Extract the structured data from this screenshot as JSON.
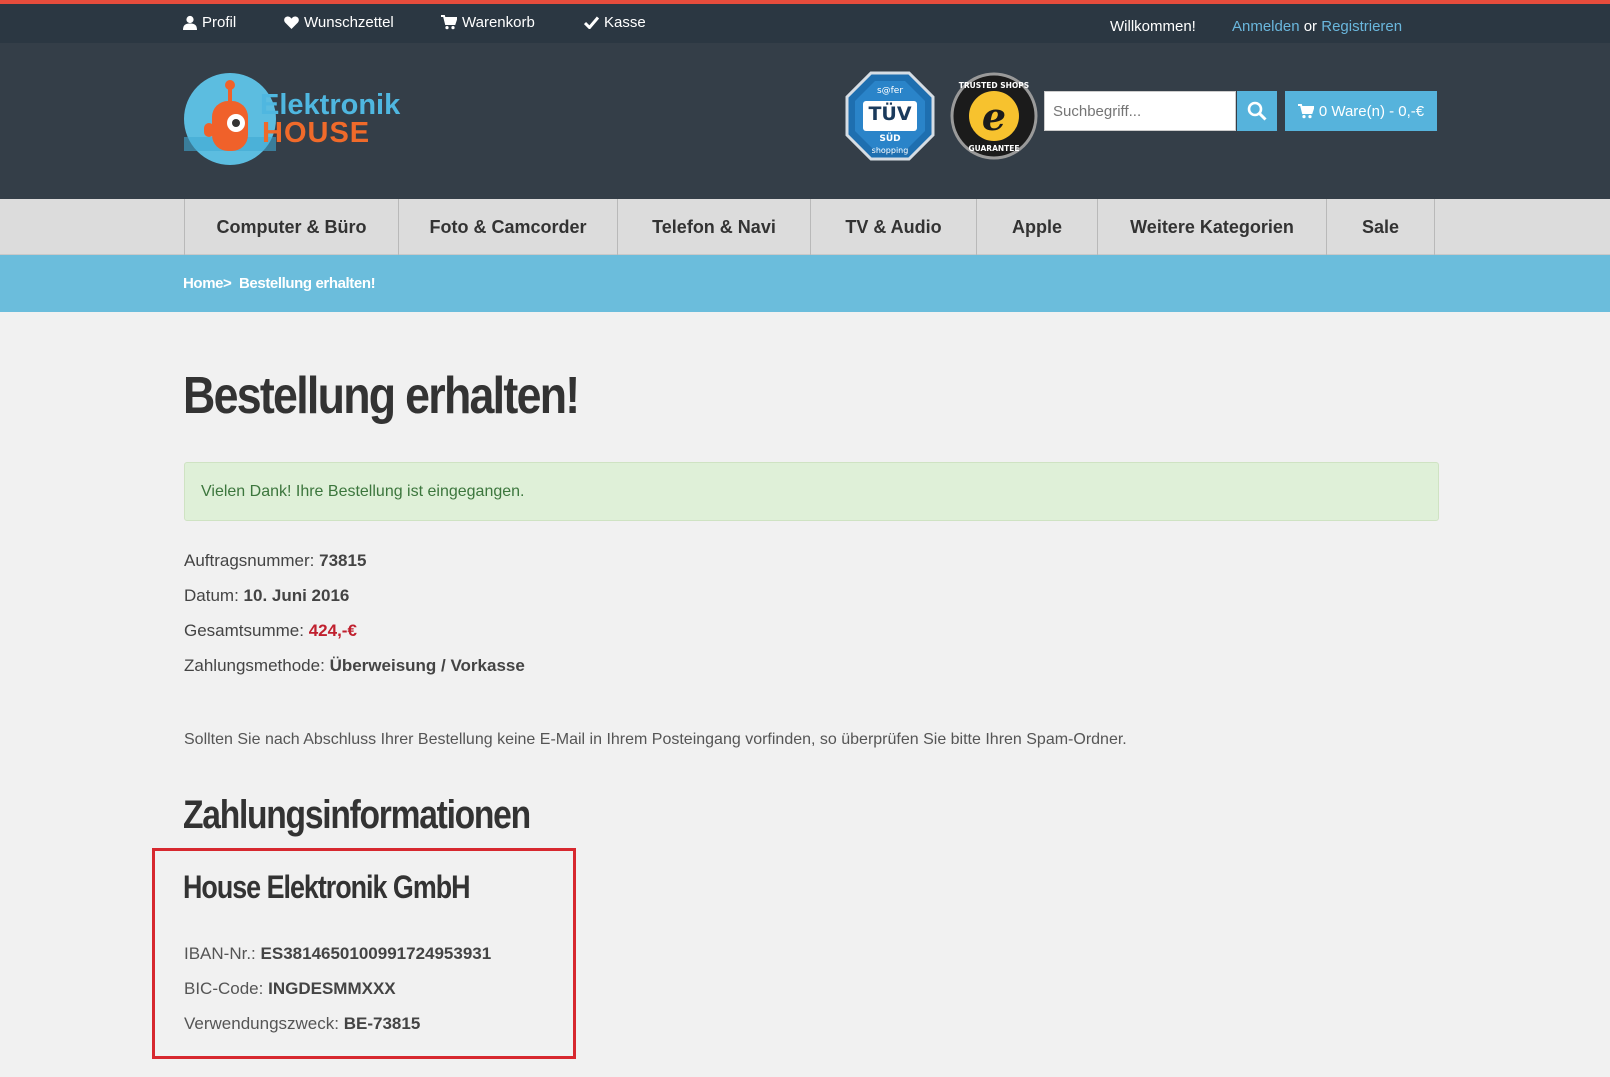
{
  "topbar": {
    "profile_label": "Profil",
    "wishlist_label": "Wunschzettel",
    "cart_label": "Warenkorb",
    "checkout_label": "Kasse",
    "welcome": "Willkommen!",
    "login_label": "Anmelden",
    "or_label": "or",
    "register_label": "Registrieren"
  },
  "header": {
    "logo_line1": "Elektronik",
    "logo_line2": "HOUSE",
    "tuv_top": "s@fer",
    "tuv_main": "TÜV",
    "tuv_sub": "SÜD",
    "tuv_bottom": "shopping",
    "trusted_top": "TRUSTED SHOPS",
    "trusted_bottom": "GUARANTEE",
    "trusted_letter": "e",
    "search_placeholder": "Suchbegriff...",
    "cart_summary": "0 Ware(n) - 0,-€"
  },
  "nav": {
    "items": [
      "Computer & Büro",
      "Foto & Camcorder",
      "Telefon & Navi",
      "TV & Audio",
      "Apple",
      "Weitere Kategorien",
      "Sale"
    ]
  },
  "breadcrumb": {
    "home": "Home",
    "separator": ">",
    "current": "Bestellung erhalten!"
  },
  "main": {
    "title": "Bestellung erhalten!",
    "success_message": "Vielen Dank! Ihre Bestellung ist eingegangen.",
    "order_number_label": "Auftragsnummer:",
    "order_number": "73815",
    "date_label": "Datum:",
    "date": "10. Juni 2016",
    "total_label": "Gesamtsumme:",
    "total": "424,-€",
    "payment_label": "Zahlungsmethode:",
    "payment_method": "Überweisung / Vorkasse",
    "spam_note": "Sollten Sie nach Abschluss Ihrer Bestellung keine E-Mail in Ihrem Posteingang vorfinden, so überprüfen Sie bitte Ihren Spam-Ordner."
  },
  "payment_info": {
    "heading": "Zahlungsinformationen",
    "company": "House Elektronik GmbH",
    "iban_label": "IBAN-Nr.:",
    "iban": "ES3814650100991724953931",
    "bic_label": "BIC-Code:",
    "bic": "INGDESMMXXX",
    "reference_label": "Verwendungszweck:",
    "reference": "BE-73815"
  },
  "colors": {
    "topbar_bg": "#2b3742",
    "topbar_accent": "#e74c3c",
    "header_bg": "#343e48",
    "accent_blue": "#56b3dc",
    "breadcrumb_bg": "#6bbddc",
    "success_bg": "#dff0d8",
    "total_red": "#c0202e",
    "highlight_border": "#d7282f"
  },
  "icons": [
    "user-icon",
    "heart-icon",
    "cart-icon",
    "check-icon",
    "search-icon"
  ]
}
